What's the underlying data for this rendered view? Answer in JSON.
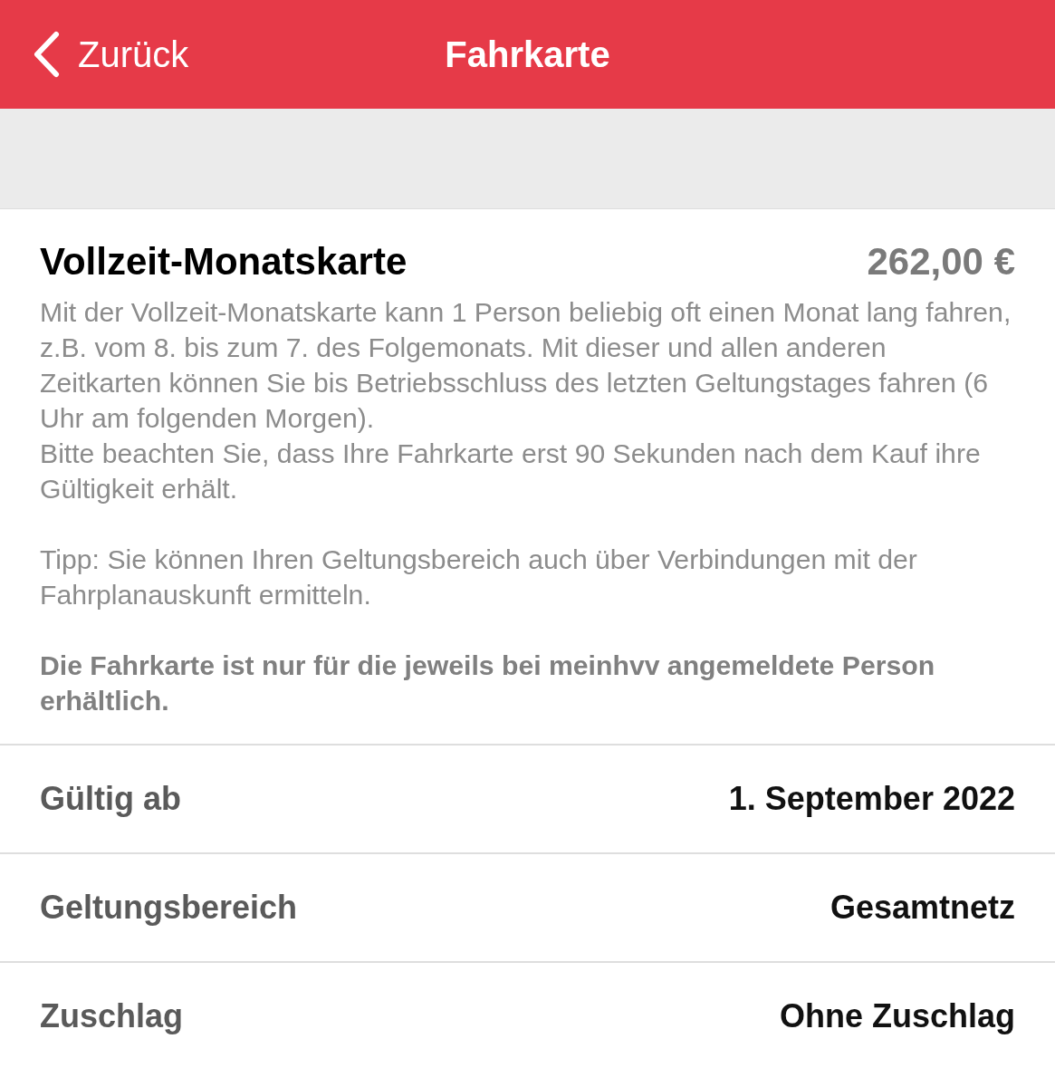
{
  "nav_bar": {
    "back_label": "Zurück",
    "title": "Fahrkarte"
  },
  "ticket": {
    "name": "Vollzeit-Monatskarte",
    "price": "262,00 €"
  },
  "description": [
    {
      "bold": false,
      "lines": [
        "Mit der Vollzeit-Monatskarte kann 1 Person beliebig oft einen Monat lang fahren, z.B. vom 8. bis zum 7. des Folgemonats. Mit dieser und allen anderen Zeitkarten können Sie bis Betriebsschluss des letzten Geltungstages fahren (6 Uhr am folgenden Morgen).",
        "Bitte beachten Sie, dass Ihre Fahrkarte erst 90 Sekunden nach dem Kauf ihre Gültigkeit erhält."
      ]
    },
    {
      "bold": false,
      "lines": [
        "Tipp: Sie können Ihren Geltungsbereich auch über Verbindungen mit der Fahrplanauskunft ermitteln."
      ]
    },
    {
      "bold": true,
      "lines": [
        "Die Fahrkarte ist nur für die jeweils bei meinhvv angemeldete Person erhältlich."
      ]
    }
  ],
  "details": [
    {
      "label": "Gültig ab",
      "value": "1. September 2022"
    },
    {
      "label": "Geltungsbereich",
      "value": "Gesamtnetz"
    },
    {
      "label": "Zuschlag",
      "value": "Ohne Zuschlag"
    }
  ]
}
